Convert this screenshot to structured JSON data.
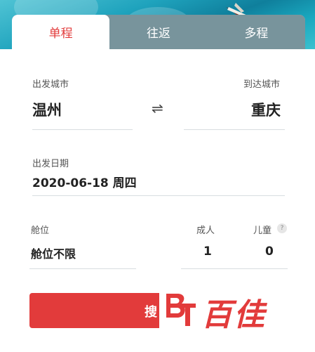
{
  "tabs": [
    "单程",
    "往返",
    "多程"
  ],
  "departure": {
    "label": "出发城市",
    "city": "温州"
  },
  "arrival": {
    "label": "到达城市",
    "city": "重庆"
  },
  "swap_symbol": "⇌",
  "date": {
    "label": "出发日期",
    "value": "2020-06-18 周四"
  },
  "cabin": {
    "label": "舱位",
    "value": "舱位不限"
  },
  "adults": {
    "label": "成人",
    "value": "1"
  },
  "children": {
    "label": "儿童",
    "value": "0",
    "help": "?"
  },
  "search_label": "搜",
  "watermark": {
    "text": "百佳",
    "logo_text": "BT"
  },
  "colors": {
    "accent": "#e23b3b",
    "banner": "#1fa3bd"
  }
}
